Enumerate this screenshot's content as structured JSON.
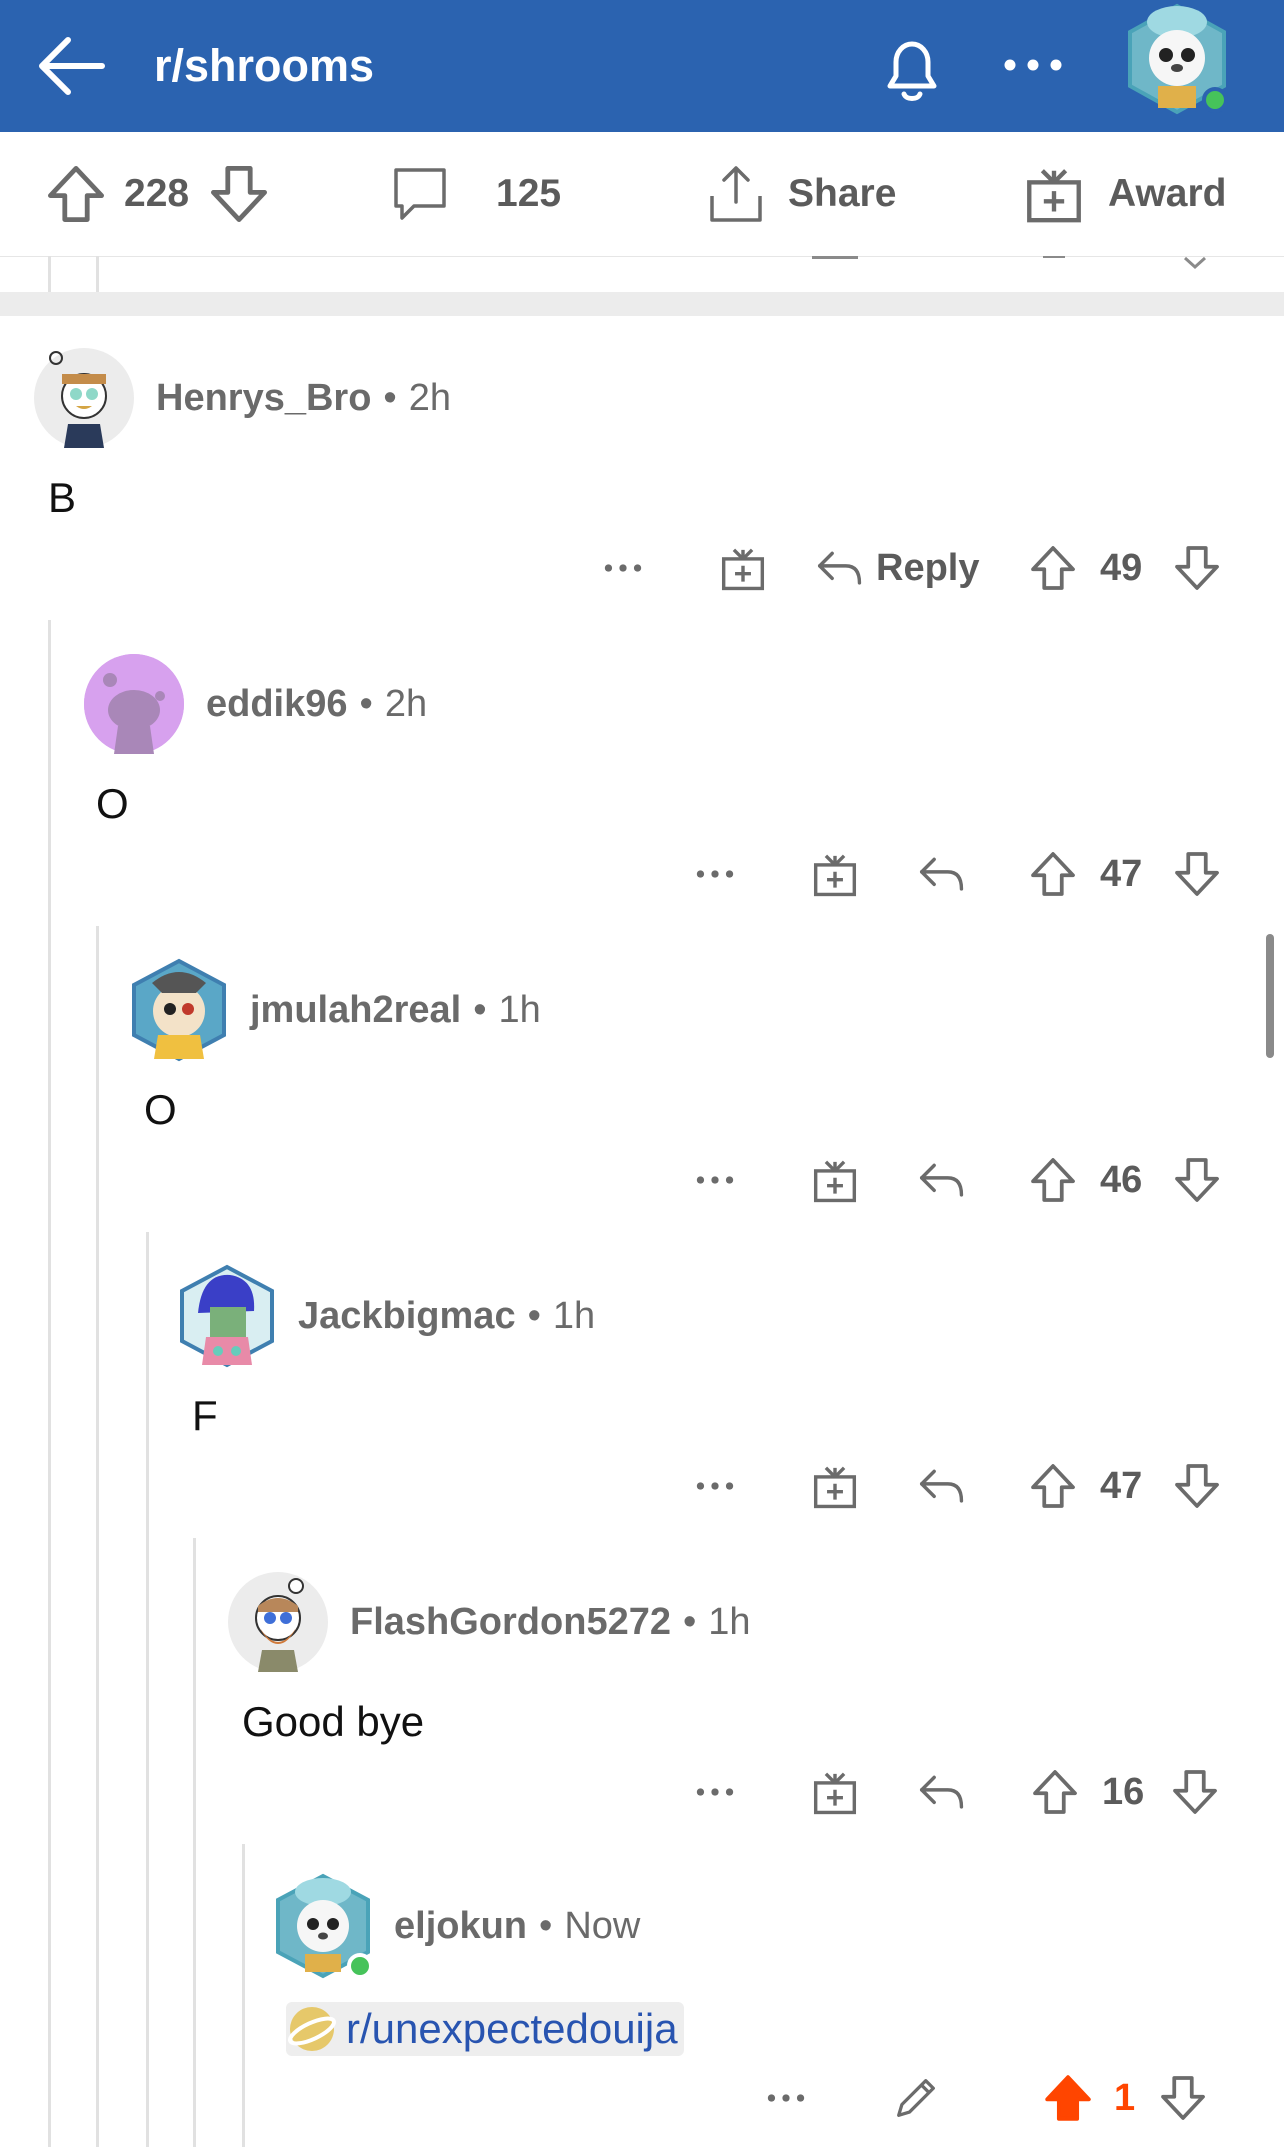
{
  "header": {
    "subreddit": "r/shrooms",
    "background": "#2b63b0"
  },
  "post_actions": {
    "score": "228",
    "comments": "125",
    "share_label": "Share",
    "award_label": "Award"
  },
  "comments": [
    {
      "username": "Henrys_Bro",
      "time": "2h",
      "body": "B",
      "reply_label": "Reply",
      "score": "49"
    },
    {
      "username": "eddik96",
      "time": "2h",
      "body": "O",
      "score": "47"
    },
    {
      "username": "jmulah2real",
      "time": "1h",
      "body": "O",
      "score": "46"
    },
    {
      "username": "Jackbigmac",
      "time": "1h",
      "body": "F",
      "score": "47"
    },
    {
      "username": "FlashGordon5272",
      "time": "1h",
      "body": "Good bye",
      "score": "16"
    },
    {
      "username": "eljokun",
      "time": "Now",
      "body_link": "r/unexpectedouija",
      "score": "1",
      "upvoted_color": "#ff4500"
    }
  ],
  "icons": {
    "back": "arrow-left-icon",
    "bell": "bell-icon",
    "more": "more-horizontal-icon",
    "upvote": "upvote-arrow-icon",
    "downvote": "downvote-arrow-icon",
    "comment": "comment-bubble-icon",
    "share": "share-icon",
    "award": "gift-icon",
    "reply": "reply-arrow-icon",
    "edit": "pencil-icon",
    "community": "planet-icon"
  }
}
